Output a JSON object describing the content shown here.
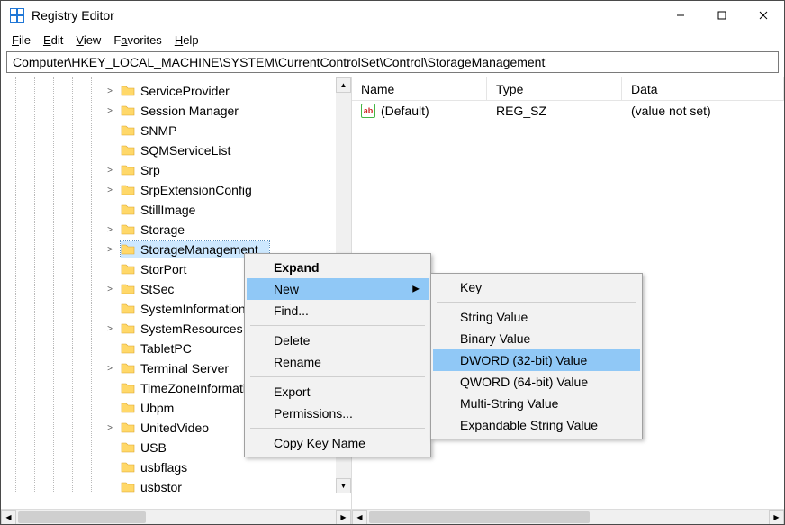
{
  "title": "Registry Editor",
  "menubar": [
    {
      "label": "File",
      "mnemonic": 0
    },
    {
      "label": "Edit",
      "mnemonic": 0
    },
    {
      "label": "View",
      "mnemonic": 0
    },
    {
      "label": "Favorites",
      "mnemonic": 1
    },
    {
      "label": "Help",
      "mnemonic": 0
    }
  ],
  "address": "Computer\\HKEY_LOCAL_MACHINE\\SYSTEM\\CurrentControlSet\\Control\\StorageManagement",
  "tree_items": [
    {
      "label": "ServiceProvider",
      "expandable": true
    },
    {
      "label": "Session Manager",
      "expandable": true
    },
    {
      "label": "SNMP",
      "expandable": false
    },
    {
      "label": "SQMServiceList",
      "expandable": false
    },
    {
      "label": "Srp",
      "expandable": true
    },
    {
      "label": "SrpExtensionConfig",
      "expandable": true
    },
    {
      "label": "StillImage",
      "expandable": false
    },
    {
      "label": "Storage",
      "expandable": true
    },
    {
      "label": "StorageManagement",
      "expandable": true,
      "selected": true
    },
    {
      "label": "StorPort",
      "expandable": false
    },
    {
      "label": "StSec",
      "expandable": true
    },
    {
      "label": "SystemInformation",
      "expandable": false
    },
    {
      "label": "SystemResources",
      "expandable": true
    },
    {
      "label": "TabletPC",
      "expandable": false
    },
    {
      "label": "Terminal Server",
      "expandable": true
    },
    {
      "label": "TimeZoneInformation",
      "expandable": false
    },
    {
      "label": "Ubpm",
      "expandable": false
    },
    {
      "label": "UnitedVideo",
      "expandable": true
    },
    {
      "label": "USB",
      "expandable": false
    },
    {
      "label": "usbflags",
      "expandable": false
    },
    {
      "label": "usbstor",
      "expandable": false
    }
  ],
  "list": {
    "columns": {
      "name": "Name",
      "type": "Type",
      "data": "Data"
    },
    "rows": [
      {
        "icon": "ab",
        "name": "(Default)",
        "type": "REG_SZ",
        "data": "(value not set)"
      }
    ]
  },
  "context_menu": {
    "items": [
      {
        "label": "Expand",
        "bold": true
      },
      {
        "label": "New",
        "submenu": true,
        "highlight": true
      },
      {
        "label": "Find..."
      },
      {
        "sep": true
      },
      {
        "label": "Delete"
      },
      {
        "label": "Rename"
      },
      {
        "sep": true
      },
      {
        "label": "Export"
      },
      {
        "label": "Permissions..."
      },
      {
        "sep": true
      },
      {
        "label": "Copy Key Name"
      }
    ]
  },
  "submenu": {
    "items": [
      {
        "label": "Key"
      },
      {
        "sep": true
      },
      {
        "label": "String Value"
      },
      {
        "label": "Binary Value"
      },
      {
        "label": "DWORD (32-bit) Value",
        "highlight": true
      },
      {
        "label": "QWORD (64-bit) Value"
      },
      {
        "label": "Multi-String Value"
      },
      {
        "label": "Expandable String Value"
      }
    ]
  }
}
